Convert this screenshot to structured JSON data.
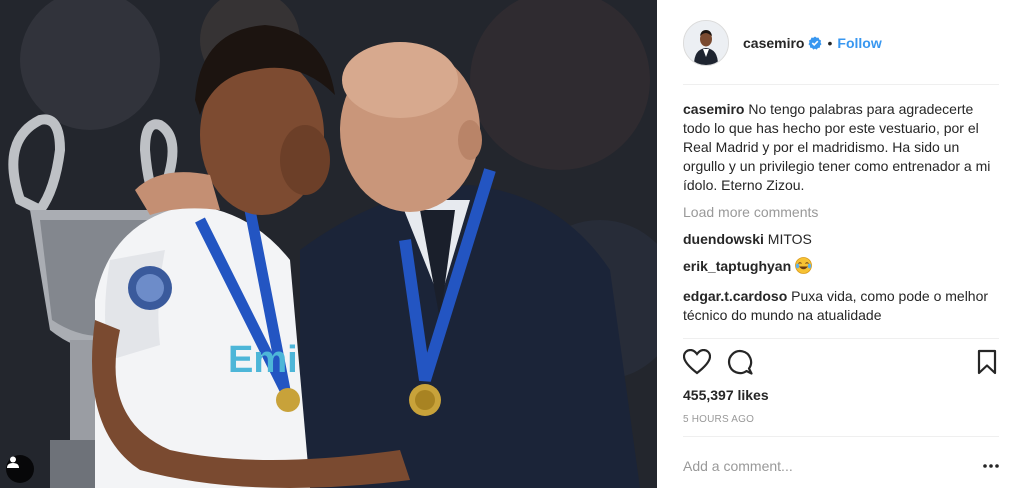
{
  "post": {
    "username": "casemiro",
    "follow_label": "Follow",
    "separator": "•",
    "caption": "No tengo palabras para agradecerte todo lo que has hecho por este vestuario, por el Real Madrid y por el madridismo. Ha sido un orgullo y un privilegio tener como entrenador a mi ídolo. Eterno Zizou.",
    "load_more": "Load more comments",
    "comments": [
      {
        "user": "duendowski",
        "text": "MITOS"
      },
      {
        "user": "erik_taptughyan",
        "text": ""
      },
      {
        "user": "edgar.t.cardoso",
        "text": "Puxa vida, como pode o melhor técnico do mundo na atualidade"
      }
    ],
    "likes": "455,397 likes",
    "time_ago": "5 HOURS AGO",
    "comment_placeholder": "Add a comment...",
    "photo_texts": {
      "shirt": "Emi"
    }
  },
  "icons": {
    "verified": "verified-badge-icon",
    "like": "heart-icon",
    "comment": "comment-bubble-icon",
    "save": "bookmark-icon",
    "more": "ellipsis-icon",
    "tag": "user-tag-icon",
    "emoji": "grinning-tears-emoji"
  },
  "colors": {
    "follow": "#3897f0",
    "muted": "#999999",
    "text": "#262626",
    "verified": "#3897f0"
  }
}
